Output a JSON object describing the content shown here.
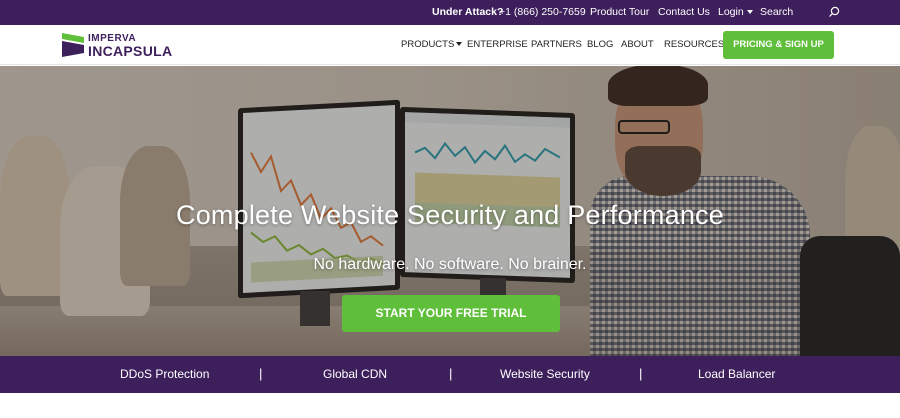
{
  "topbar": {
    "under_attack": "Under Attack?",
    "phone": "+1 (866) 250-7659",
    "product_tour": "Product Tour",
    "contact_us": "Contact Us",
    "login": "Login",
    "search_placeholder": "Search",
    "search_icon": "search-icon"
  },
  "logo": {
    "line1": "IMPERVA",
    "line2": "INCAPSULA"
  },
  "nav": {
    "products": "PRODUCTS",
    "enterprise": "ENTERPRISE",
    "partners": "PARTNERS",
    "blog": "BLOG",
    "about": "ABOUT",
    "resources": "RESOURCES",
    "cta": "PRICING & SIGN UP"
  },
  "hero": {
    "title": "Complete Website Security and Performance",
    "subtitle": "No hardware. No software. No brainer.",
    "cta": "START YOUR FREE TRIAL"
  },
  "services": {
    "items": [
      "DDoS Protection",
      "Global CDN",
      "Website Security",
      "Load Balancer"
    ],
    "separator": "|"
  },
  "colors": {
    "brand_purple": "#3d1f5c",
    "accent_green": "#5fbe3a"
  }
}
